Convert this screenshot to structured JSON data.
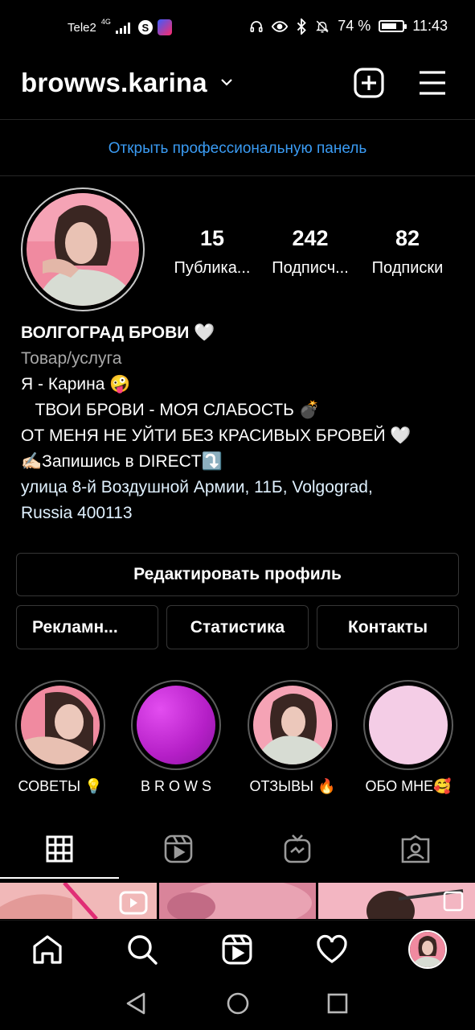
{
  "status_bar": {
    "carrier": "Tele2",
    "network": "4G",
    "battery": "74 %",
    "battery_level": 0.74,
    "time": "11:43"
  },
  "header": {
    "username": "browws.karina",
    "icons": [
      "chevron-down-icon",
      "add-post-icon",
      "menu-icon"
    ]
  },
  "pro_panel_link": "Открыть профессиональную панель",
  "stats": [
    {
      "value": "15",
      "label": "Публика..."
    },
    {
      "value": "242",
      "label": "Подписч..."
    },
    {
      "value": "82",
      "label": "Подписки"
    }
  ],
  "bio": {
    "name": "ВОЛГОГРАД БРОВИ 🤍",
    "category": "Товар/услуга",
    "lines": [
      "Я - Карина 🤪",
      "   ТВОИ БРОВИ - МОЯ СЛАБОСТЬ 💣",
      "ОТ МЕНЯ НЕ УЙТИ БЕЗ КРАСИВЫХ БРОВЕЙ 🤍",
      "✍🏻Запишись в DIRECT⤵️"
    ],
    "address_lines": [
      "улица 8-й Воздушной Армии, 11Б, Volgograd,",
      "Russia 400113"
    ]
  },
  "buttons": {
    "edit_profile": "Редактировать профиль",
    "ads": "Рекламн...",
    "insights": "Статистика",
    "contacts": "Контакты"
  },
  "highlights": [
    {
      "label": "СОВЕТЫ 💡"
    },
    {
      "label": "B R O W S"
    },
    {
      "label": "ОТЗЫВЫ 🔥"
    },
    {
      "label": "ОБО МНЕ🥰"
    }
  ],
  "tabs": [
    "grid-icon",
    "reels-icon",
    "igtv-icon",
    "tagged-icon"
  ],
  "bottom_nav": [
    "home-icon",
    "search-icon",
    "reels-icon",
    "heart-icon",
    "profile-avatar"
  ],
  "colors": {
    "background": "#000000",
    "link_blue": "#3a9bf3",
    "muted": "#a8a8a8",
    "border": "#363636",
    "accent_pink": "#f08aa0"
  }
}
